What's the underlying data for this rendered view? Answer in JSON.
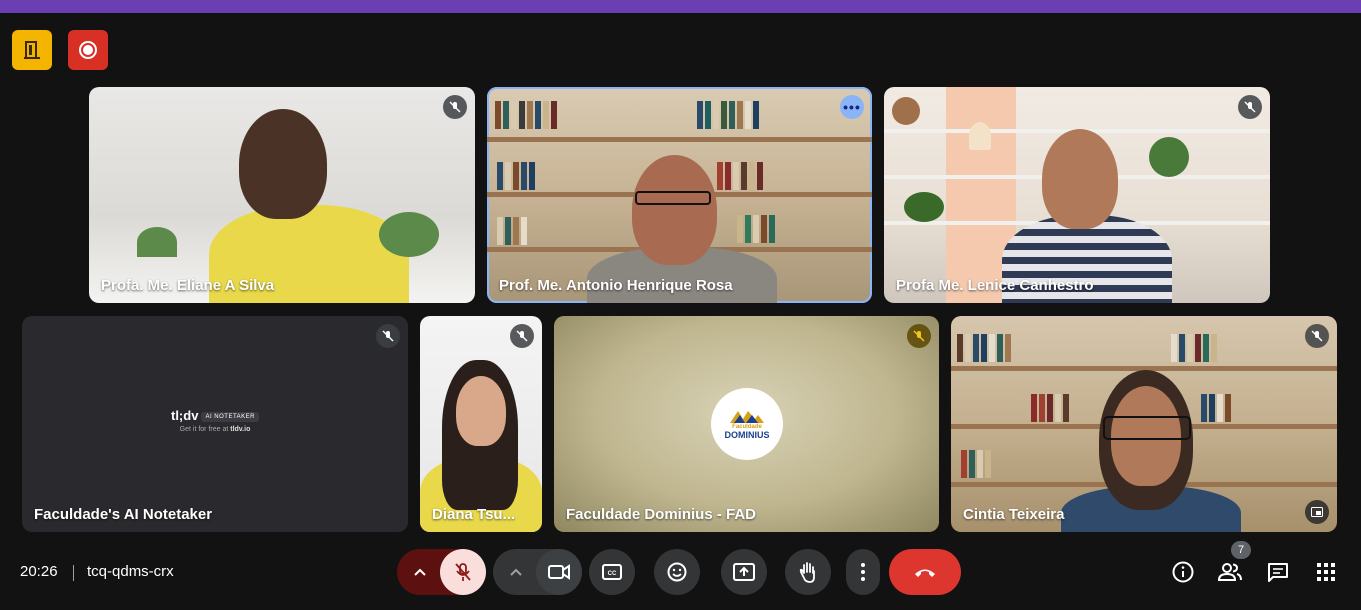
{
  "corner_buttons": {
    "left": "door-icon",
    "right": "record-icon"
  },
  "participants": [
    {
      "name": "Profa. Me. Eliane A Silva",
      "muted": true
    },
    {
      "name": "Prof. Me. Antonio Henrique Rosa",
      "muted": false,
      "active_speaker": true
    },
    {
      "name": "Profa Me. Lenice Canhestro",
      "muted": true
    },
    {
      "name": "Faculdade's AI Notetaker",
      "muted": true
    },
    {
      "name": "Diana Tsu...",
      "muted": true
    },
    {
      "name": "Faculdade Dominius - FAD",
      "muted": true
    },
    {
      "name": "Cintia Teixeira",
      "muted": true
    }
  ],
  "notetaker": {
    "brand": "tl;dv",
    "badge": "AI NOTETAKER",
    "sub_prefix": "Get it for free at",
    "sub_link": "tldv.io"
  },
  "dominius_logo": {
    "line1": "Faculdade",
    "line2": "DOMINIUS"
  },
  "meeting": {
    "time": "20:26",
    "code": "tcq-qdms-crx",
    "participant_count": "7"
  },
  "controls": [
    "microphone",
    "camera",
    "captions",
    "emoji",
    "present",
    "raise-hand",
    "more-options",
    "end-call"
  ],
  "colors": {
    "end_call": "#dc362e",
    "mic_off_bg": "#f9dedc",
    "accent": "#8ab4f8",
    "topbar": "#6a3fb3"
  }
}
